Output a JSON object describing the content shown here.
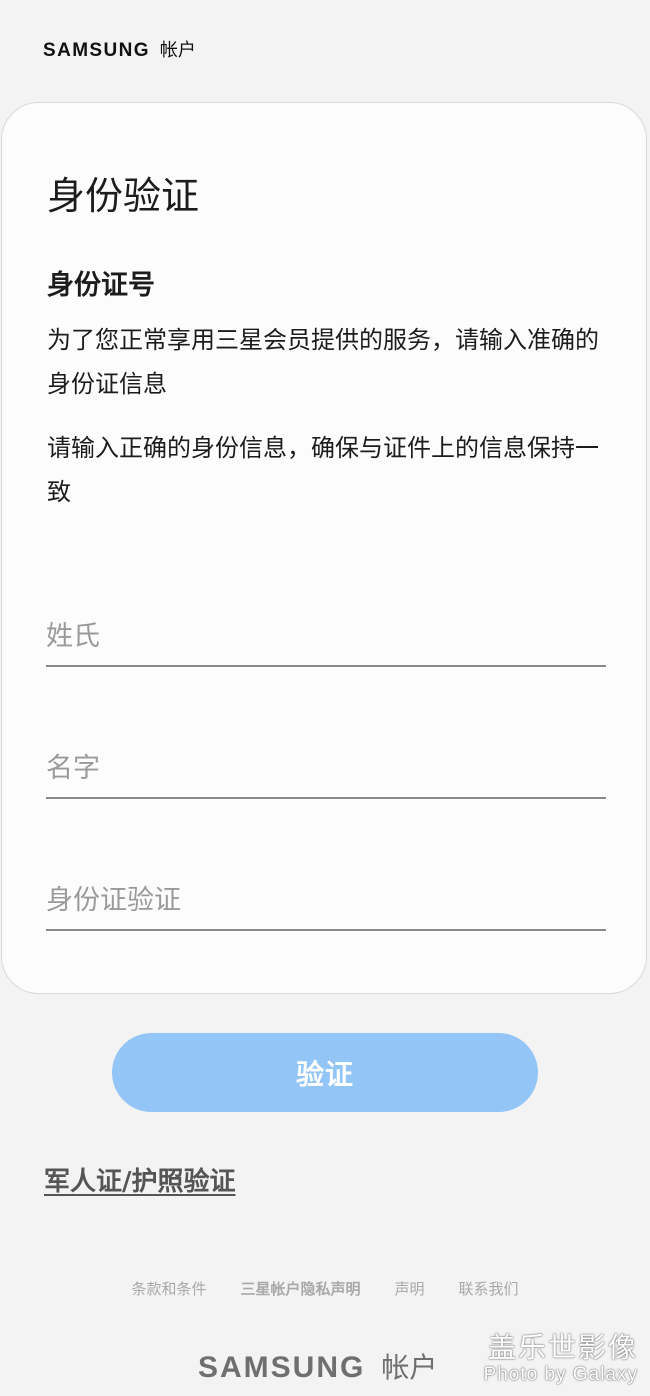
{
  "header": {
    "brand": "SAMSUNG",
    "brand_suffix": "帐户"
  },
  "card": {
    "title": "身份验证",
    "section_title": "身份证号",
    "description_1": "为了您正常享用三星会员提供的服务，请输入准确的身份证信息",
    "description_2": "请输入正确的身份信息，确保与证件上的信息保持一致",
    "fields": [
      {
        "placeholder": "姓氏",
        "value": ""
      },
      {
        "placeholder": "名字",
        "value": ""
      },
      {
        "placeholder": "身份证验证",
        "value": ""
      }
    ]
  },
  "verify_button": {
    "label": "验证",
    "color": "#93c5f6"
  },
  "alt_verification_link": "军人证/护照验证",
  "footer": {
    "links": [
      "条款和条件",
      "三星帐户隐私声明",
      "声明",
      "联系我们"
    ],
    "brand": "SAMSUNG",
    "brand_suffix": "帐户"
  },
  "watermark": {
    "line_1": "盖乐世影像",
    "line_2": "Photo by Galaxy"
  }
}
